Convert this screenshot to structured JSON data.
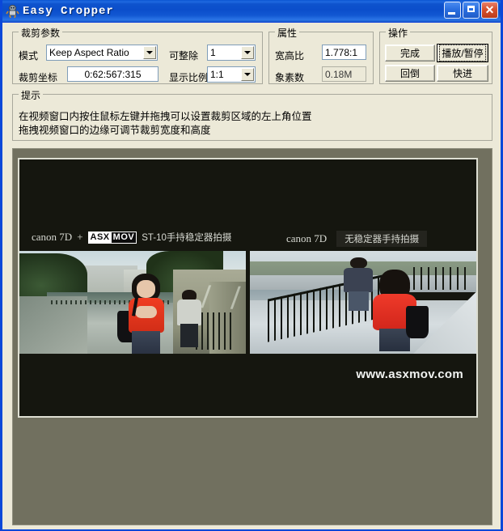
{
  "window": {
    "title": "Easy Cropper",
    "icon": "app-icon",
    "buttons": {
      "minimize": "minimize-icon",
      "maximize": "maximize-icon",
      "close": "close-icon"
    }
  },
  "crop_params": {
    "legend": "裁剪参数",
    "mode_label": "模式",
    "mode_value": "Keep Aspect Ratio",
    "coords_label": "裁剪坐标",
    "coords_value": "0:62:567:315",
    "divisible_label": "可整除",
    "divisible_value": "1",
    "display_ratio_label": "显示比例",
    "display_ratio_value": "1:1"
  },
  "attributes": {
    "legend": "属性",
    "aspect_label": "宽高比",
    "aspect_value": "1.778:1",
    "pixels_label": "象素数",
    "pixels_value": "0.18M"
  },
  "operations": {
    "legend": "操作",
    "done": "完成",
    "play_pause": "播放/暂停",
    "rewind": "回倒",
    "forward": "快进"
  },
  "hint": {
    "legend": "提示",
    "line1": "在视频窗口内按住鼠标左键并拖拽可以设置裁剪区域的左上角位置",
    "line2": "拖拽视频窗口的边缘可调节裁剪宽度和高度"
  },
  "video": {
    "caption_left_brand": "canon  7D",
    "caption_left_plus": "+",
    "logo_part1": "ASX",
    "logo_part2": "MOV",
    "caption_left_text": "ST-10手持稳定器拍摄",
    "caption_right_brand": "canon  7D",
    "caption_right_text": "无稳定器手持拍摄",
    "watermark": "www.asxmov.com"
  },
  "colors": {
    "titlebar": "#0b4ecb",
    "window_face": "#ece9d8",
    "video_panel": "#71705f",
    "video_bg": "#15160f",
    "accent_red": "#ef3a2a"
  }
}
